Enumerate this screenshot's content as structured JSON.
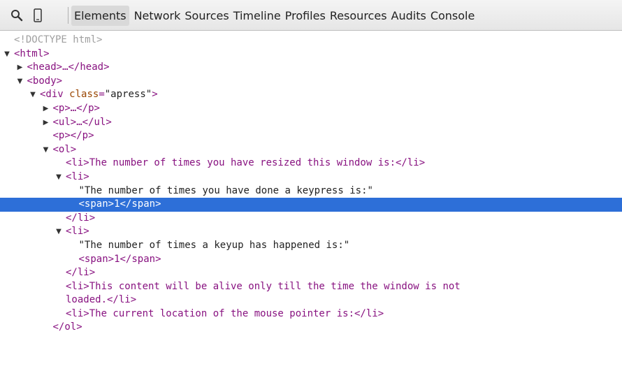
{
  "toolbar": {
    "search_icon": "search-icon",
    "device_icon": "device-mode-icon",
    "tabs": [
      {
        "label": "Elements",
        "active": true
      },
      {
        "label": "Network"
      },
      {
        "label": "Sources"
      },
      {
        "label": "Timeline"
      },
      {
        "label": "Profiles"
      },
      {
        "label": "Resources"
      },
      {
        "label": "Audits"
      },
      {
        "label": "Console"
      }
    ]
  },
  "dom_tree": {
    "lines": [
      {
        "indent": 0,
        "expand": "",
        "kind": "doctype",
        "text": "<!DOCTYPE html>"
      },
      {
        "indent": 0,
        "expand": "open",
        "kind": "tag",
        "text": "<html>"
      },
      {
        "indent": 1,
        "expand": "closed",
        "kind": "tag",
        "text": "<head>…</head>"
      },
      {
        "indent": 1,
        "expand": "open",
        "kind": "tag",
        "text": "<body>"
      },
      {
        "indent": 2,
        "expand": "open",
        "kind": "tag",
        "text": "<div class=\"apress\">"
      },
      {
        "indent": 3,
        "expand": "closed",
        "kind": "tag",
        "text": "<p>…</p>"
      },
      {
        "indent": 3,
        "expand": "closed",
        "kind": "tag",
        "text": "<ul>…</ul>"
      },
      {
        "indent": 3,
        "expand": "",
        "kind": "tag",
        "text": "<p></p>"
      },
      {
        "indent": 3,
        "expand": "open",
        "kind": "tag",
        "text": "<ol>"
      },
      {
        "indent": 4,
        "expand": "",
        "kind": "tag",
        "text": "<li>The number of times you have resized this window is:</li>"
      },
      {
        "indent": 4,
        "expand": "open",
        "kind": "tag",
        "text": "<li>"
      },
      {
        "indent": 5,
        "expand": "",
        "kind": "text",
        "text": "\"The number of times you have done a keypress is:\""
      },
      {
        "indent": 5,
        "expand": "",
        "kind": "tag",
        "text": "<span>1</span>",
        "selected": true
      },
      {
        "indent": 4,
        "expand": "",
        "kind": "tag",
        "text": "</li>"
      },
      {
        "indent": 4,
        "expand": "open",
        "kind": "tag",
        "text": "<li>"
      },
      {
        "indent": 5,
        "expand": "",
        "kind": "text",
        "text": "\"The number of times a keyup has happened is:\""
      },
      {
        "indent": 5,
        "expand": "",
        "kind": "tag",
        "text": "<span>1</span>"
      },
      {
        "indent": 4,
        "expand": "",
        "kind": "tag",
        "text": "</li>"
      },
      {
        "indent": 4,
        "expand": "",
        "kind": "tag",
        "text": "<li>This content will be alive only till the time the window is not"
      },
      {
        "indent": 4,
        "expand": "",
        "kind": "tag",
        "text": "loaded.</li>"
      },
      {
        "indent": 4,
        "expand": "",
        "kind": "tag",
        "text": "<li>The current location of the mouse pointer is:</li>"
      },
      {
        "indent": 3,
        "expand": "",
        "kind": "tag",
        "text": "</ol>"
      }
    ]
  }
}
